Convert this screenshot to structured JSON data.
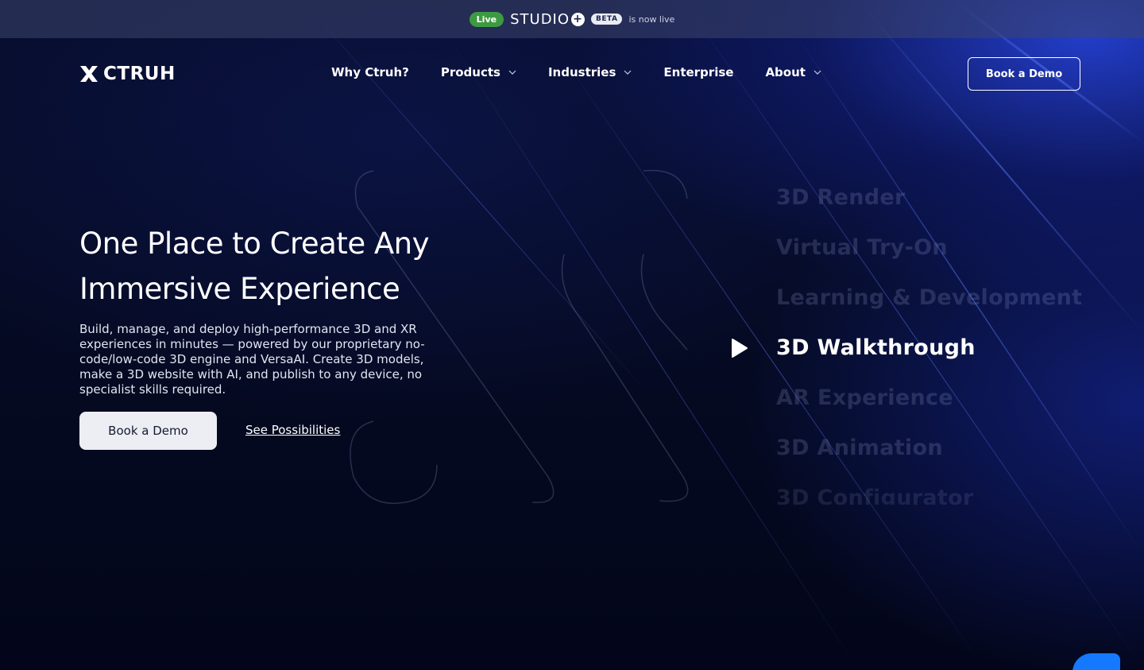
{
  "announcement": {
    "live_label": "Live",
    "studio_name": "STUDIO",
    "beta_label": "BETA",
    "text": "is now live"
  },
  "nav": {
    "logo_text": "CTRUH",
    "items": [
      {
        "label": "Why Ctruh?",
        "has_dropdown": false
      },
      {
        "label": "Products",
        "has_dropdown": true
      },
      {
        "label": "Industries",
        "has_dropdown": true
      },
      {
        "label": "Enterprise",
        "has_dropdown": false
      },
      {
        "label": "About",
        "has_dropdown": true
      }
    ],
    "cta_label": "Book a Demo"
  },
  "hero": {
    "title_line1": "One Place to Create Any",
    "title_line2": "Immersive Experience",
    "description": "Build, manage, and deploy high-performance 3D and XR experiences in minutes — powered by our proprietary no-code/low-code 3D engine and VersaAI. Create 3D models, make a 3D website with AI, and publish to any device, no specialist skills required.",
    "primary_cta": "Book a Demo",
    "secondary_cta": "See Possibilities"
  },
  "experiences": {
    "items": [
      "3D Render",
      "Virtual Try-On",
      "Learning & Development",
      "3D Walkthrough",
      "AR Experience",
      "3D Animation",
      "3D Configurator"
    ],
    "active_index": 3
  },
  "colors": {
    "background": "#050a1f",
    "accent_blue": "#1479ff",
    "live_green": "#3d9a42"
  }
}
